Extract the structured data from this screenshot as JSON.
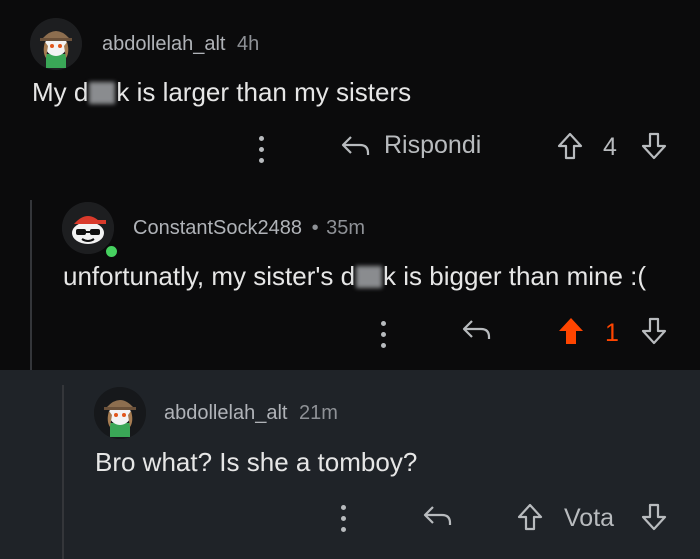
{
  "comments": [
    {
      "username": "abdollelah_alt",
      "time": "4h",
      "text_before": "My d",
      "text_after": "k is larger than my sisters",
      "reply_label": "Rispondi",
      "vote_count": "4"
    },
    {
      "username": "ConstantSock2488",
      "separator": "•",
      "time": "35m",
      "text_before": "unfortunatly, my sister's d",
      "text_after": "k is bigger than mine :(",
      "vote_count": "1"
    },
    {
      "username": "abdollelah_alt",
      "time": "21m",
      "text": "Bro what? Is she a tomboy?",
      "vote_label": "Vota"
    }
  ],
  "colors": {
    "background": "#0b0b0c",
    "highlight_background": "#1f2328",
    "upvoted": "#ff4500",
    "online_dot": "#46d160"
  },
  "icons": [
    "more-options-icon",
    "reply-arrow-icon",
    "upvote-icon",
    "downvote-icon",
    "online-status-icon"
  ]
}
